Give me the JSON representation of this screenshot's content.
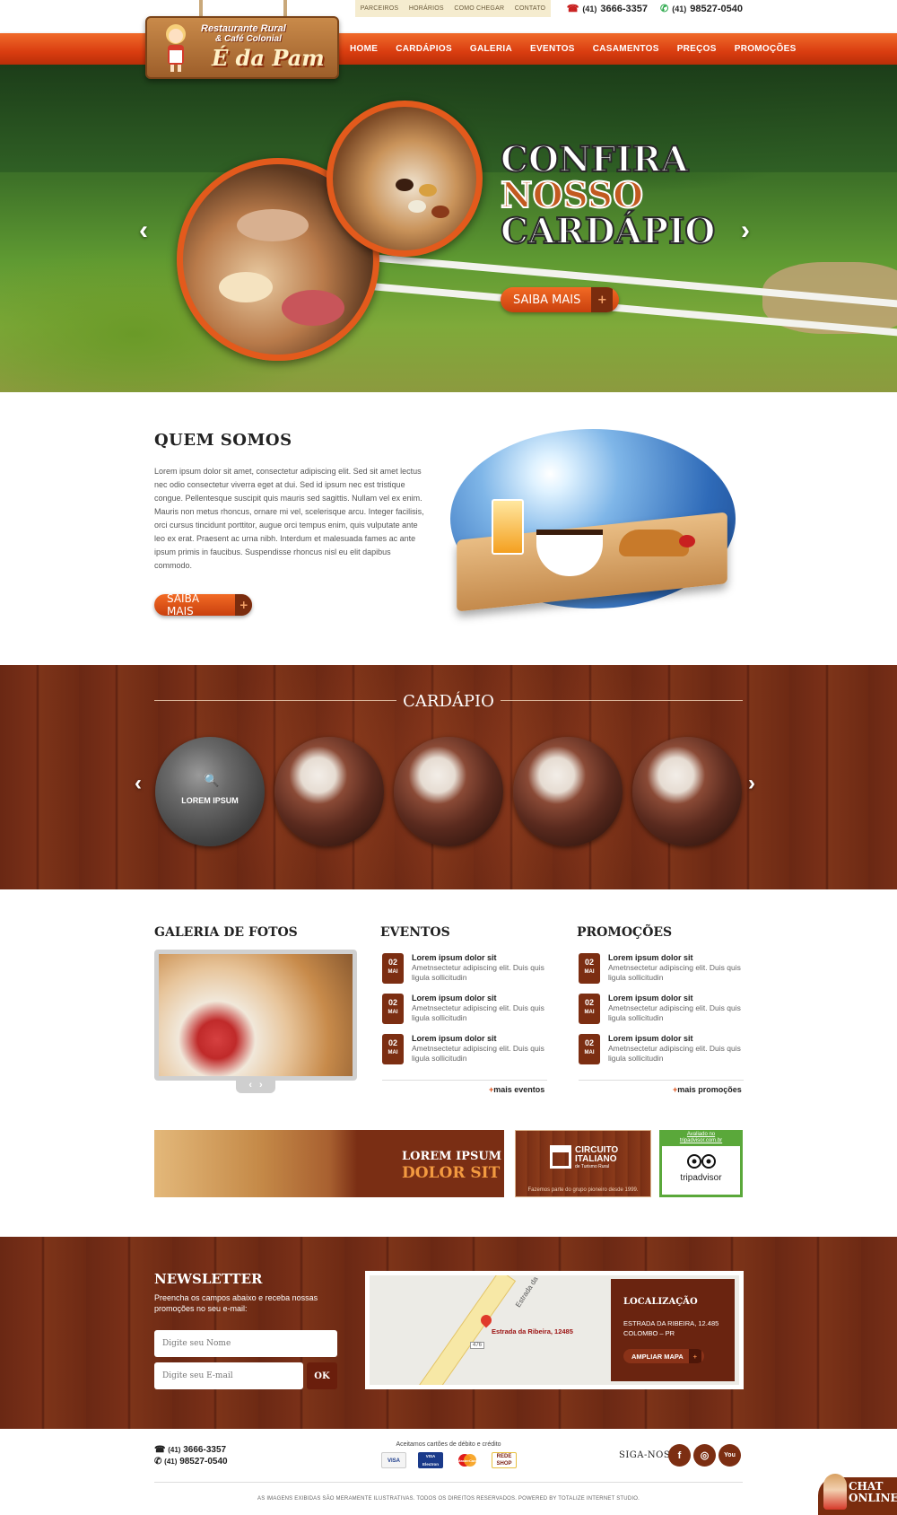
{
  "header": {
    "top_links": [
      "PARCEIROS",
      "HORÁRIOS",
      "COMO CHEGAR",
      "CONTATO"
    ],
    "phone1_ddd": "(41)",
    "phone1": "3666-3357",
    "phone2_ddd": "(41)",
    "phone2": "98527-0540",
    "logo_line1": "Restaurante Rural",
    "logo_line2": "& Café Colonial",
    "logo_line3": "É da Pam",
    "nav": [
      "HOME",
      "CARDÁPIOS",
      "GALERIA",
      "EVENTOS",
      "CASAMENTOS",
      "PREÇOS",
      "PROMOÇÕES"
    ]
  },
  "hero": {
    "title_line1": "CONFIRA",
    "title_line2": "NOSSO",
    "title_line3": "CARDÁPIO",
    "button": "SAIBA MAIS",
    "plus": "+",
    "prev": "‹",
    "next": "›"
  },
  "quem_somos": {
    "title": "QUEM SOMOS",
    "text": "Lorem ipsum dolor sit amet, consectetur adipiscing elit. Sed sit amet lectus nec odio consectetur viverra eget at dui. Sed id ipsum nec est tristique congue. Pellentesque suscipit quis mauris sed sagittis. Nullam vel ex enim. Mauris non metus rhoncus, ornare mi vel, scelerisque arcu. Integer facilisis, orci cursus tincidunt porttitor, augue orci tempus enim, quis vulputate ante leo ex erat. Praesent ac urna nibh. Interdum et malesuada fames ac ante ipsum primis in faucibus. Suspendisse rhoncus nisl eu elit dapibus commodo.",
    "button": "SAIBA MAIS",
    "plus": "+"
  },
  "cardapio": {
    "title": "CARDÁPIO",
    "active_label": "LOREM IPSUM",
    "search_icon": "🔍",
    "prev": "‹",
    "next": "›"
  },
  "galeria": {
    "title": "GALERIA DE FOTOS",
    "prev": "‹",
    "next": "›"
  },
  "eventos": {
    "title": "EVENTOS",
    "items": [
      {
        "day": "02",
        "month": "MAI",
        "title": "Lorem ipsum dolor sit",
        "text": "Ametnsectetur adipiscing elit. Duis quis ligula sollicitudin"
      },
      {
        "day": "02",
        "month": "MAI",
        "title": "Lorem ipsum dolor sit",
        "text": "Ametnsectetur adipiscing elit. Duis quis ligula sollicitudin"
      },
      {
        "day": "02",
        "month": "MAI",
        "title": "Lorem ipsum dolor sit",
        "text": "Ametnsectetur adipiscing elit. Duis quis ligula sollicitudin"
      }
    ],
    "more_plus": "+",
    "more": "mais eventos"
  },
  "promocoes": {
    "title": "PROMOÇÕES",
    "items": [
      {
        "day": "02",
        "month": "MAI",
        "title": "Lorem ipsum dolor sit",
        "text": "Ametnsectetur adipiscing elit. Duis quis ligula sollicitudin"
      },
      {
        "day": "02",
        "month": "MAI",
        "title": "Lorem ipsum dolor sit",
        "text": "Ametnsectetur adipiscing elit. Duis quis ligula sollicitudin"
      },
      {
        "day": "02",
        "month": "MAI",
        "title": "Lorem ipsum dolor sit",
        "text": "Ametnsectetur adipiscing elit. Duis quis ligula sollicitudin"
      }
    ],
    "more_plus": "+",
    "more": "mais promoções"
  },
  "banners": {
    "b1_line1": "LOREM IPSUM",
    "b1_line2": "DOLOR SIT",
    "b2_name1": "CIRCUITO",
    "b2_name2": "ITALIANO",
    "b2_name3": "de Turismo Rural",
    "b2_caption": "Fazemos parte do grupo pioneiro desde 1999.",
    "b3_caption1": "Avaliado no",
    "b3_caption2": "tripadvisor.com.br",
    "b3_brand": "tripadvisor"
  },
  "newsletter": {
    "title": "NEWSLETTER",
    "text": "Preencha os campos abaixo e receba nossas promoções no seu e-mail:",
    "name_placeholder": "Digite seu Nome",
    "email_placeholder": "Digite seu E-mail",
    "ok": "OK"
  },
  "map": {
    "road_label": "Estrada da",
    "pin_label": "Estrada da Ribeira, 12485",
    "shield": "476",
    "loc_title": "LOCALIZAÇÃO",
    "loc_line1": "ESTRADA DA RIBEIRA, 12.485",
    "loc_line2": "COLOMBO – PR",
    "button": "AMPLIAR MAPA",
    "plus": "+"
  },
  "footer": {
    "phone1_ddd": "(41)",
    "phone1": "3666-3357",
    "phone2_ddd": "(41)",
    "phone2": "98527-0540",
    "cards_title": "Aceitamos cartões de débito e crédito",
    "cards": [
      "VISA",
      "VISA Electron",
      "MasterCard",
      "REDE SHOP"
    ],
    "siga": "SIGA-NOS",
    "social": [
      "f",
      "◎",
      "You"
    ],
    "copyright": "AS IMAGENS EXIBIDAS SÃO MERAMENTE ILUSTRATIVAS. TODOS OS DIREITOS RESERVADOS. POWERED BY TOTALIZE INTERNET STUDIO.",
    "chat1": "CHAT",
    "chat2": "ONLINE"
  },
  "colors": {
    "accent": "#d9480f",
    "brown": "#7c2e12",
    "wood": "#6e2a14"
  }
}
